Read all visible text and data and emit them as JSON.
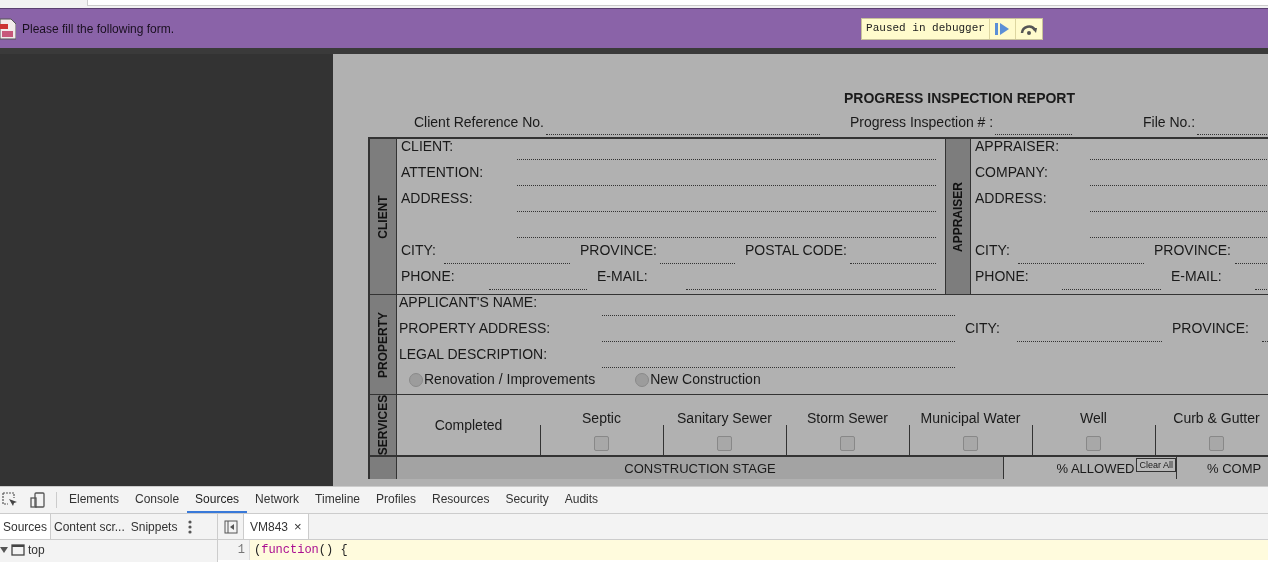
{
  "notification": {
    "message": "Please fill the following form.",
    "debugger_label": "Paused in debugger"
  },
  "form": {
    "title": "PROGRESS INSPECTION REPORT",
    "header_fields": [
      {
        "label": "Client Reference No."
      },
      {
        "label": "Progress Inspection # :"
      },
      {
        "label": "File No.:"
      }
    ],
    "client": {
      "section_label": "CLIENT",
      "rows": [
        {
          "fields": [
            {
              "label": "CLIENT:",
              "kind": "line"
            }
          ]
        },
        {
          "fields": [
            {
              "label": "ATTENTION:",
              "kind": "line"
            }
          ]
        },
        {
          "fields": [
            {
              "label": "ADDRESS:",
              "kind": "double"
            }
          ]
        },
        {
          "fields": [
            {
              "label": "CITY:",
              "kind": "line"
            },
            {
              "label": "PROVINCE:",
              "kind": "line"
            },
            {
              "label": "POSTAL CODE:",
              "kind": "line"
            }
          ]
        },
        {
          "fields": [
            {
              "label": "PHONE:",
              "kind": "line"
            },
            {
              "label": "E-MAIL:",
              "kind": "line"
            }
          ]
        }
      ]
    },
    "appraiser": {
      "section_label": "APPRAISER",
      "rows": [
        {
          "fields": [
            {
              "label": "APPRAISER:",
              "kind": "line"
            }
          ]
        },
        {
          "fields": [
            {
              "label": "COMPANY:",
              "kind": "line"
            }
          ]
        },
        {
          "fields": [
            {
              "label": "ADDRESS:",
              "kind": "double"
            }
          ]
        },
        {
          "fields": [
            {
              "label": "CITY:",
              "kind": "line"
            },
            {
              "label": "PROVINCE:",
              "kind": "line"
            }
          ]
        },
        {
          "fields": [
            {
              "label": "PHONE:",
              "kind": "line"
            },
            {
              "label": "E-MAIL:",
              "kind": "line"
            }
          ]
        }
      ]
    },
    "property": {
      "section_label": "PROPERTY",
      "rows": [
        {
          "fields": [
            {
              "label": "APPLICANT'S NAME:",
              "kind": "line"
            }
          ]
        },
        {
          "fields": [
            {
              "label": "PROPERTY ADDRESS:",
              "kind": "line"
            },
            {
              "label": "CITY:",
              "kind": "line"
            },
            {
              "label": "PROVINCE:",
              "kind": "line"
            }
          ]
        },
        {
          "fields": [
            {
              "label": "LEGAL DESCRIPTION:",
              "kind": "line"
            }
          ]
        }
      ],
      "options": [
        {
          "label": "Renovation / Improvements",
          "selected": false
        },
        {
          "label": "New Construction",
          "selected": false
        }
      ]
    },
    "services": {
      "section_label": "SERVICES",
      "row_label": "Completed",
      "items": [
        {
          "label": "Septic",
          "checked": false
        },
        {
          "label": "Sanitary Sewer",
          "checked": false
        },
        {
          "label": "Storm Sewer",
          "checked": false
        },
        {
          "label": "Municipal Water",
          "checked": false
        },
        {
          "label": "Well",
          "checked": false
        },
        {
          "label": "Curb & Gutter",
          "checked": false
        }
      ]
    },
    "stage_header": {
      "column_1": "CONSTRUCTION STAGE",
      "column_2": "% ALLOWED",
      "clear_button": "Clear All",
      "column_3": "% COMP"
    }
  },
  "devtools": {
    "tabs": [
      {
        "label": "Elements",
        "selected": false
      },
      {
        "label": "Console",
        "selected": false
      },
      {
        "label": "Sources",
        "selected": true
      },
      {
        "label": "Network",
        "selected": false
      },
      {
        "label": "Timeline",
        "selected": false
      },
      {
        "label": "Profiles",
        "selected": false
      },
      {
        "label": "Resources",
        "selected": false
      },
      {
        "label": "Security",
        "selected": false
      },
      {
        "label": "Audits",
        "selected": false
      }
    ],
    "navigator_tabs": [
      {
        "label": "Sources",
        "selected": true
      },
      {
        "label": "Content scr...",
        "selected": false
      },
      {
        "label": "Snippets",
        "selected": false
      }
    ],
    "tree": [
      {
        "label": "top",
        "expanded": true
      }
    ],
    "file_tab": {
      "label": "VM843",
      "close": "×"
    },
    "code_lines": [
      {
        "number": "1",
        "tokens": [
          {
            "text": "(",
            "kind": "plain"
          },
          {
            "text": "function",
            "kind": "keyword"
          },
          {
            "text": "() {",
            "kind": "plain"
          }
        ]
      }
    ]
  }
}
